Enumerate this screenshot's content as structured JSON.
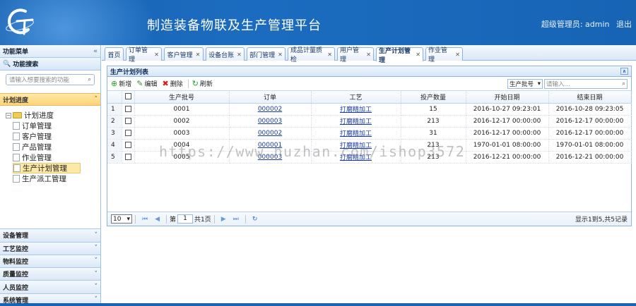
{
  "header": {
    "title": "制造装备物联及生产管理平台",
    "user_label": "超级管理员: admin",
    "logout": "退出"
  },
  "sidebar": {
    "title": "功能菜单",
    "collapse_glyph": "«",
    "search_title": "功能搜索",
    "search_placeholder": "请输入想要搜索的功能",
    "active_section": "计划进度",
    "tree_root": "计划进度",
    "tree_items": [
      "订单管理",
      "客户管理",
      "产品管理",
      "作业管理",
      "生产计划管理",
      "生产派工管理"
    ],
    "selected_item": "生产计划管理",
    "sections": [
      "设备管理",
      "工艺监控",
      "物料监控",
      "质量监控",
      "人员监控",
      "系统管理"
    ]
  },
  "tabs": [
    {
      "label": "首页",
      "closable": false
    },
    {
      "label": "订单管理",
      "closable": true
    },
    {
      "label": "客户管理",
      "closable": true
    },
    {
      "label": "设备台账",
      "closable": true
    },
    {
      "label": "部门管理",
      "closable": true
    },
    {
      "label": "成品计量质检",
      "closable": true
    },
    {
      "label": "用户管理",
      "closable": true
    },
    {
      "label": "生产计划管理",
      "closable": true,
      "active": true
    },
    {
      "label": "作业管理",
      "closable": true
    }
  ],
  "panel": {
    "title": "生产计划列表",
    "toolbar": {
      "add": "新增",
      "edit": "编辑",
      "delete": "删除",
      "refresh": "刷新"
    },
    "search_field_selected": "生产批号",
    "search_placeholder": "请输入..."
  },
  "grid": {
    "columns": [
      "生产批号",
      "订单",
      "工艺",
      "投产数量",
      "开始日期",
      "结束日期"
    ],
    "rows": [
      {
        "num": "1",
        "batch": "0001",
        "order": "000002",
        "process": "打磨精加工",
        "qty": "15",
        "start": "2016-10-27 09:23:01",
        "end": "2016-10-28 09:23:05"
      },
      {
        "num": "2",
        "batch": "0002",
        "order": "000003",
        "process": "打磨精加工",
        "qty": "213",
        "start": "2016-12-17 00:00:00",
        "end": "2016-12-17 00:00:00"
      },
      {
        "num": "3",
        "batch": "0003",
        "order": "000002",
        "process": "打磨精加工",
        "qty": "31",
        "start": "2016-12-17 00:00:00",
        "end": "2016-12-17 00:00:00"
      },
      {
        "num": "4",
        "batch": "0004",
        "order": "000001",
        "process": "打磨精加工",
        "qty": "213",
        "start": "1970-01-01 08:00:00",
        "end": "1970-01-01 08:00:00"
      },
      {
        "num": "5",
        "batch": "0005",
        "order": "000003",
        "process": "打磨精加工",
        "qty": "213",
        "start": "2016-12-21 00:00:00",
        "end": "2016-12-21 00:00:00"
      }
    ]
  },
  "pager": {
    "page_size": "10",
    "page_prefix": "第",
    "current_page": "1",
    "page_suffix": "共1页",
    "info": "显示1到5,共5记录"
  },
  "watermark": "https://www.huzhan.com/ishop3572",
  "colors": {
    "header_blue": "#1a63b3",
    "active_section": "#fdd377",
    "link": "#1a3aa8"
  }
}
